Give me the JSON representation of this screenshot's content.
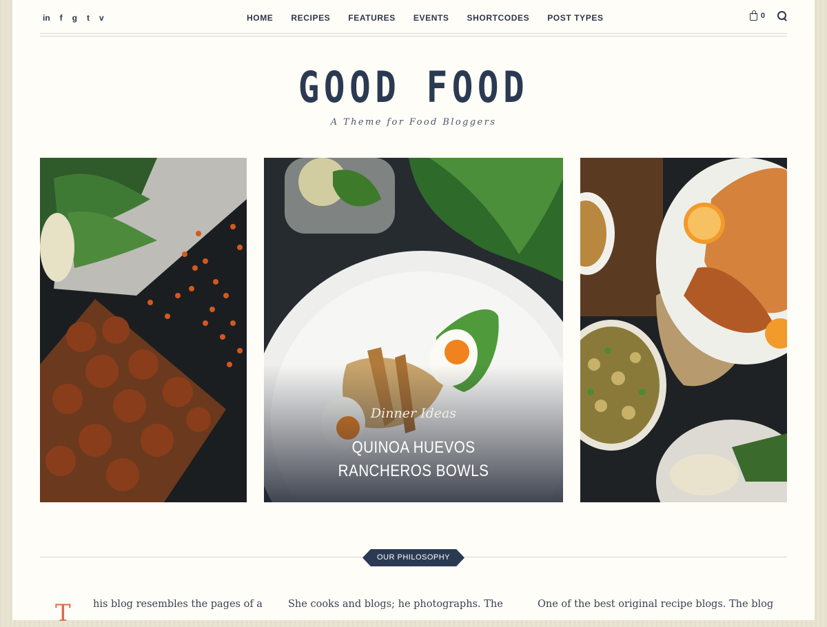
{
  "social": {
    "linkedin": "in",
    "facebook": "f",
    "googleplus": "g",
    "twitter": "t",
    "vimeo": "v"
  },
  "nav": [
    "HOME",
    "RECIPES",
    "FEATURES",
    "EVENTS",
    "SHORTCODES",
    "POST TYPES"
  ],
  "cart": {
    "count": "0"
  },
  "site": {
    "title": "GOOD FOOD",
    "tagline": "A Theme for Food Bloggers"
  },
  "slider": {
    "active": {
      "category": "Dinner Ideas",
      "title_line1": "QUINOA HUEVOS",
      "title_line2": "RANCHEROS BOWLS"
    }
  },
  "philosophy": {
    "badge": "OUR PHILOSOPHY",
    "dropcap": "T",
    "col1": "his blog resembles the pages of a",
    "col2": "She cooks and blogs; he photographs. The",
    "col3": "One of the best original recipe blogs. The blog"
  },
  "colors": {
    "navy": "#2b3a52",
    "accent": "#e0684a",
    "page_bg": "#fefdf8"
  }
}
